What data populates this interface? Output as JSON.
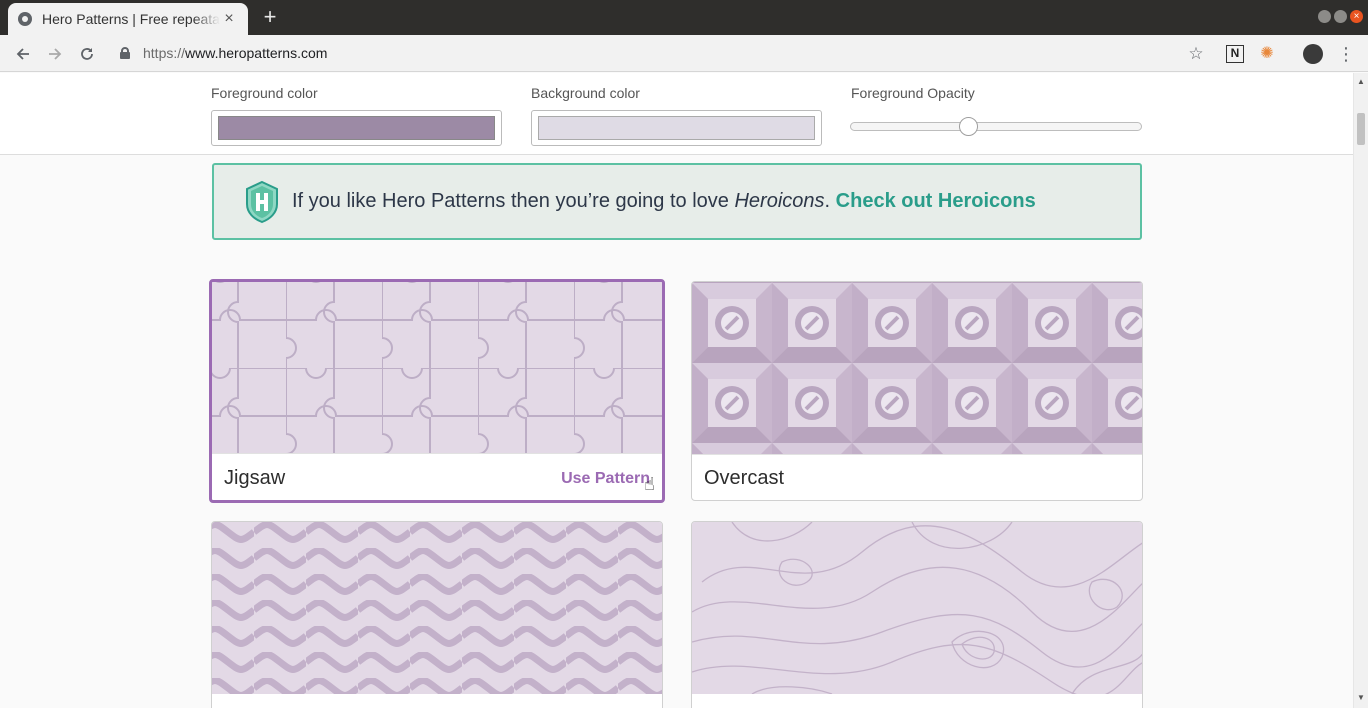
{
  "browser": {
    "tab_title": "Hero Patterns | Free repeatable SVG background patterns",
    "tab_close": "×",
    "new_tab": "+",
    "url_scheme": "https://",
    "url_host": "www.heropatterns.com",
    "icons": [
      "back-icon",
      "forward-icon",
      "reload-icon",
      "lock-icon",
      "star-icon",
      "extension-n-icon",
      "extension-orange-icon",
      "avatar-icon",
      "menu-icon"
    ]
  },
  "settings": {
    "foreground_label": "Foreground color",
    "foreground_value": "#9c8aa5",
    "background_label": "Background color",
    "background_value": "#dfdbe5",
    "opacity_label": "Foreground Opacity",
    "opacity_value": 0.4
  },
  "banner": {
    "text_before": "If you like Hero Patterns then you’re going to love ",
    "emphasis": "Heroicons",
    "text_after": ". ",
    "link": "Check out Heroicons"
  },
  "patterns": [
    {
      "name": "Jigsaw",
      "action": "Use Pattern",
      "selected": true
    },
    {
      "name": "Overcast",
      "selected": false
    },
    {
      "name": "",
      "selected": false
    },
    {
      "name": "",
      "selected": false
    }
  ],
  "colors": {
    "accent": "#9b6ab3",
    "banner_border": "#5cc1a3",
    "banner_link": "#2a9d8a"
  }
}
